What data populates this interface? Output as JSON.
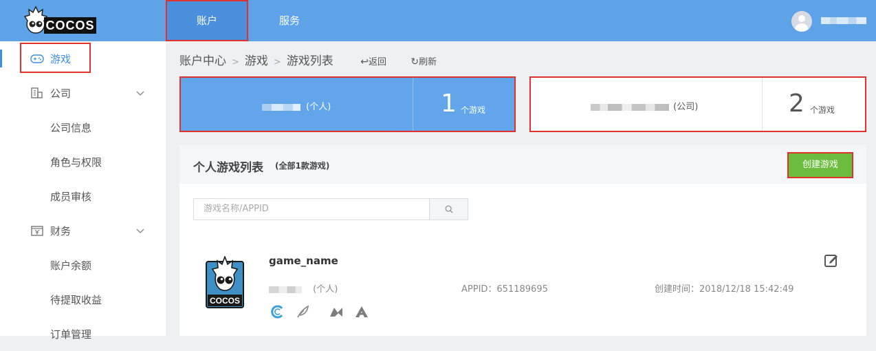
{
  "header": {
    "logo_text": "COCOS",
    "tabs": [
      {
        "label": "账户",
        "active": true
      },
      {
        "label": "服务",
        "active": false
      }
    ],
    "user": {
      "avatar_icon": "user-avatar-icon"
    }
  },
  "sidebar": {
    "items": [
      {
        "label": "游戏",
        "icon": "gamepad-icon",
        "active": true
      },
      {
        "label": "公司",
        "icon": "building-icon",
        "expandable": true
      },
      {
        "label": "公司信息"
      },
      {
        "label": "角色与权限"
      },
      {
        "label": "成员审核"
      },
      {
        "label": "财务",
        "icon": "finance-icon",
        "expandable": true
      },
      {
        "label": "账户余额"
      },
      {
        "label": "待提取收益"
      },
      {
        "label": "订单管理"
      }
    ]
  },
  "breadcrumb": {
    "items": [
      "账户中心",
      "游戏",
      "游戏列表"
    ],
    "back_label": "返回",
    "refresh_label": "刷新"
  },
  "stats": {
    "personal": {
      "type_label": "(个人)",
      "count": "1",
      "unit": "个游戏"
    },
    "company": {
      "type_label": "(公司)",
      "count": "2",
      "unit": "个游戏"
    }
  },
  "game_list": {
    "title": "个人游戏列表",
    "count_label": "(全部1款游戏)",
    "create_button": "创建游戏",
    "search": {
      "placeholder": "游戏名称/APPID"
    },
    "games": [
      {
        "name": "game_name",
        "owner_type": "(个人)",
        "appid": "APPID：651189695",
        "created": "创建时间：2018/12/18 15:42:49",
        "logo_text": "COCOS"
      }
    ]
  },
  "colors": {
    "topbar": "#5ea3e8",
    "accent": "#3f8fe4",
    "create_button": "#6cbd3e",
    "highlight_border": "#e0322b"
  }
}
